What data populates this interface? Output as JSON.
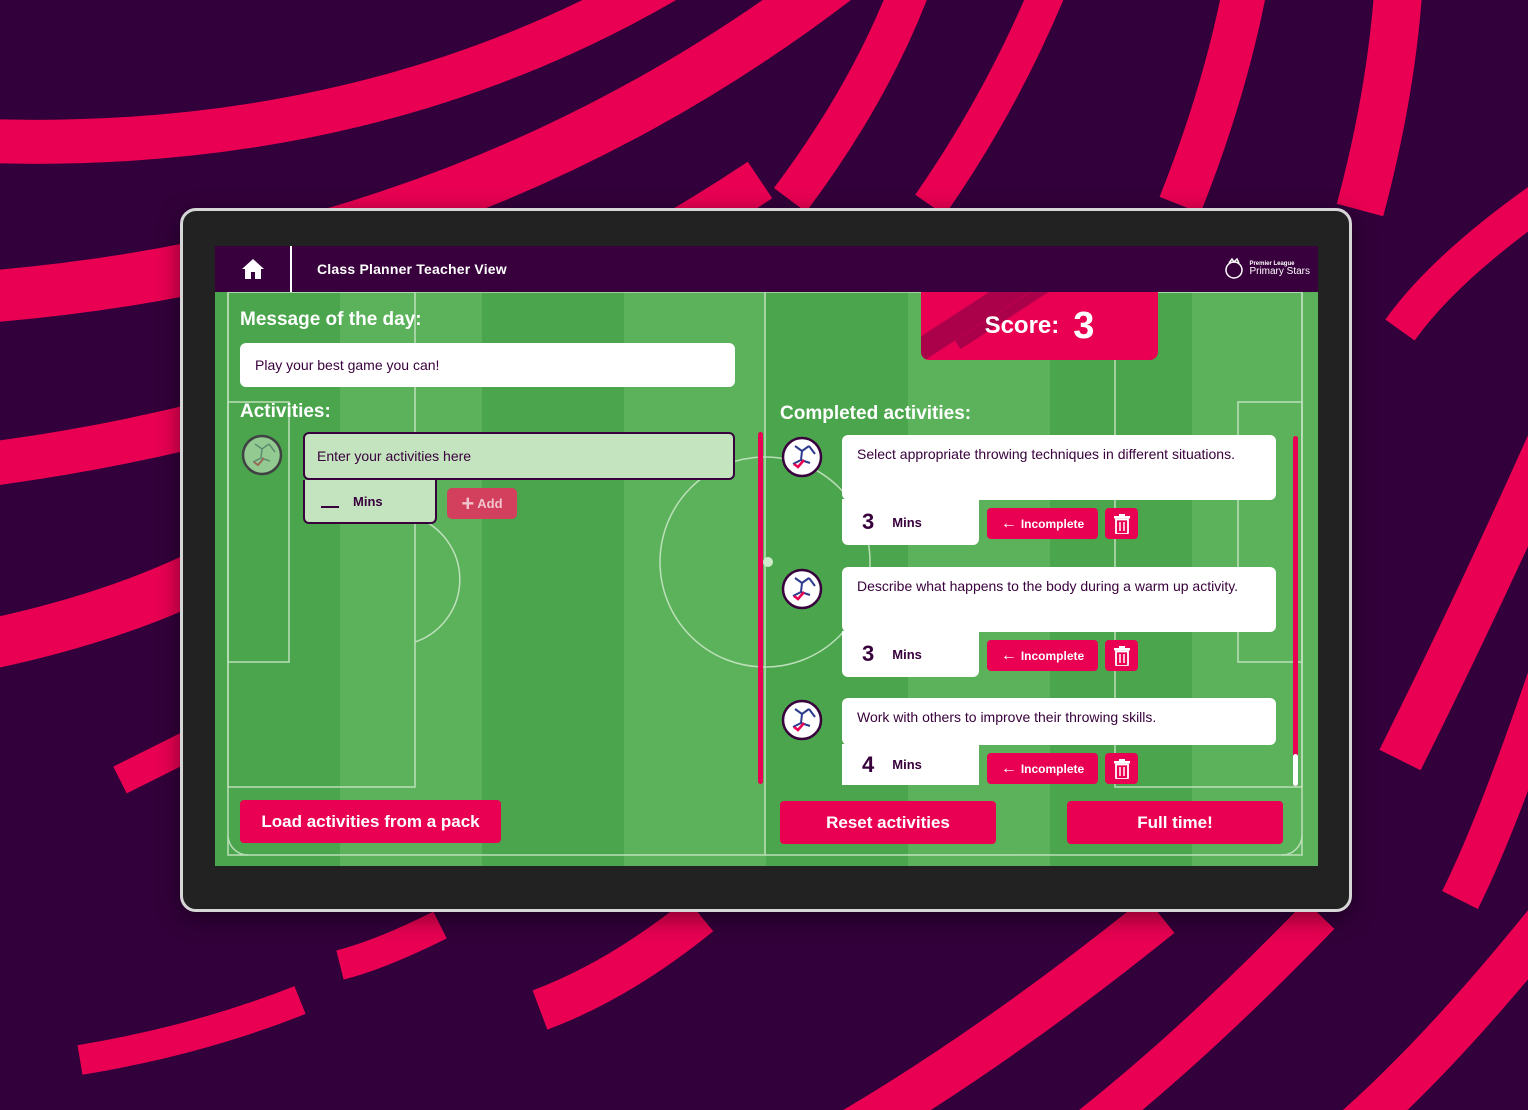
{
  "header": {
    "title": "Class Planner Teacher View",
    "brand_small": "Premier League",
    "brand_big": "Primary Stars"
  },
  "message_of_day": {
    "label": "Message of the day:",
    "text": "Play your best game you can!"
  },
  "activities": {
    "label": "Activities:",
    "placeholder": "Enter your activities here",
    "mins_label": "Mins",
    "add_label": "Add"
  },
  "score": {
    "label": "Score:",
    "value": "3"
  },
  "completed": {
    "label": "Completed activities:",
    "items": [
      {
        "text": "Select appropriate throwing techniques in different situations.",
        "mins": "3",
        "unit": "Mins",
        "status_label": "Incomplete"
      },
      {
        "text": "Describe what happens to the body during a warm up activity.",
        "mins": "3",
        "unit": "Mins",
        "status_label": "Incomplete"
      },
      {
        "text": "Work with others to improve their throwing skills.",
        "mins": "4",
        "unit": "Mins",
        "status_label": "Incomplete"
      }
    ]
  },
  "buttons": {
    "load_pack": "Load activities from a pack",
    "reset": "Reset activities",
    "full_time": "Full time!"
  },
  "colors": {
    "brand_purple": "#38003c",
    "brand_pink": "#e90052",
    "pitch_green": "#4aa54c",
    "pitch_green_light": "#5bb25a"
  },
  "icons": [
    "home-icon",
    "premier-league-lion-icon",
    "football-icon",
    "arrow-left-icon",
    "trash-icon",
    "plus-icon"
  ]
}
